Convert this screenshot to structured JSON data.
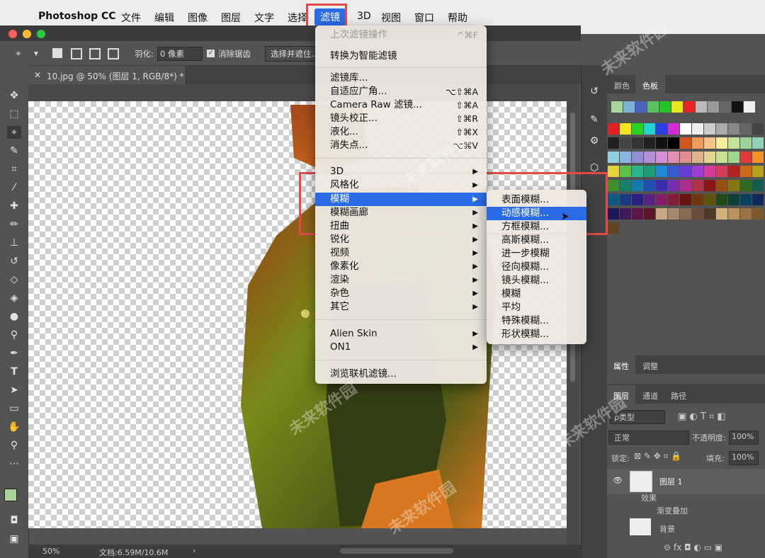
{
  "menubar": {
    "app": "Photoshop CC",
    "items": [
      "文件",
      "编辑",
      "图像",
      "图层",
      "文字",
      "选择",
      "滤镜",
      "3D",
      "视图",
      "窗口",
      "帮助"
    ],
    "selected": "滤镜"
  },
  "options": {
    "feather_label": "羽化:",
    "feather_value": "0 像素",
    "antialias_label": "消除锯齿",
    "select_mask_label": "选择并遮住..."
  },
  "document_tab": "10.jpg @ 50% (图层 1, RGB/8*) *",
  "status": {
    "zoom": "50%",
    "doc": "文档:6.59M/10.6M"
  },
  "filter_menu": {
    "last_filter": "上次滤镜操作",
    "last_filter_shortcut": "^⌘F",
    "convert_smart": "转换为智能滤镜",
    "group1": [
      {
        "label": "滤镜库...",
        "shortcut": ""
      },
      {
        "label": "自适应广角...",
        "shortcut": "⌥⇧⌘A"
      },
      {
        "label": "Camera Raw 滤镜...",
        "shortcut": "⇧⌘A"
      },
      {
        "label": "镜头校正...",
        "shortcut": "⇧⌘R"
      },
      {
        "label": "液化...",
        "shortcut": "⇧⌘X"
      },
      {
        "label": "消失点...",
        "shortcut": "⌥⌘V"
      }
    ],
    "group2": [
      "3D",
      "风格化",
      "模糊",
      "模糊画廊",
      "扭曲",
      "锐化",
      "视频",
      "像素化",
      "渲染",
      "杂色",
      "其它"
    ],
    "group3": [
      "Alien Skin",
      "ON1"
    ],
    "browse": "浏览联机滤镜..."
  },
  "blur_submenu": [
    "表面模糊...",
    "动感模糊...",
    "方框模糊...",
    "高斯模糊...",
    "进一步模糊",
    "径向模糊...",
    "镜头模糊...",
    "模糊",
    "平均",
    "特殊模糊...",
    "形状模糊..."
  ],
  "panels": {
    "color_tabs": [
      "颜色",
      "色板"
    ],
    "prop_tabs": [
      "属性",
      "调整"
    ],
    "layer_tabs": [
      "图层",
      "通道",
      "路径"
    ],
    "filter_kind": "ρ类型",
    "blend_mode": "正常",
    "opacity_label": "不透明度:",
    "opacity_value": "100%",
    "lock_label": "锁定:",
    "fill_label": "填充:",
    "fill_value": "100%",
    "layers": [
      {
        "name": "图层 1"
      },
      {
        "name": "效果"
      },
      {
        "name": "渐变叠加"
      },
      {
        "name": "背景"
      }
    ]
  },
  "watermark": "未来软件园",
  "colors": {
    "accent": "#2a6be8",
    "highlight_box": "#e34a4a"
  }
}
